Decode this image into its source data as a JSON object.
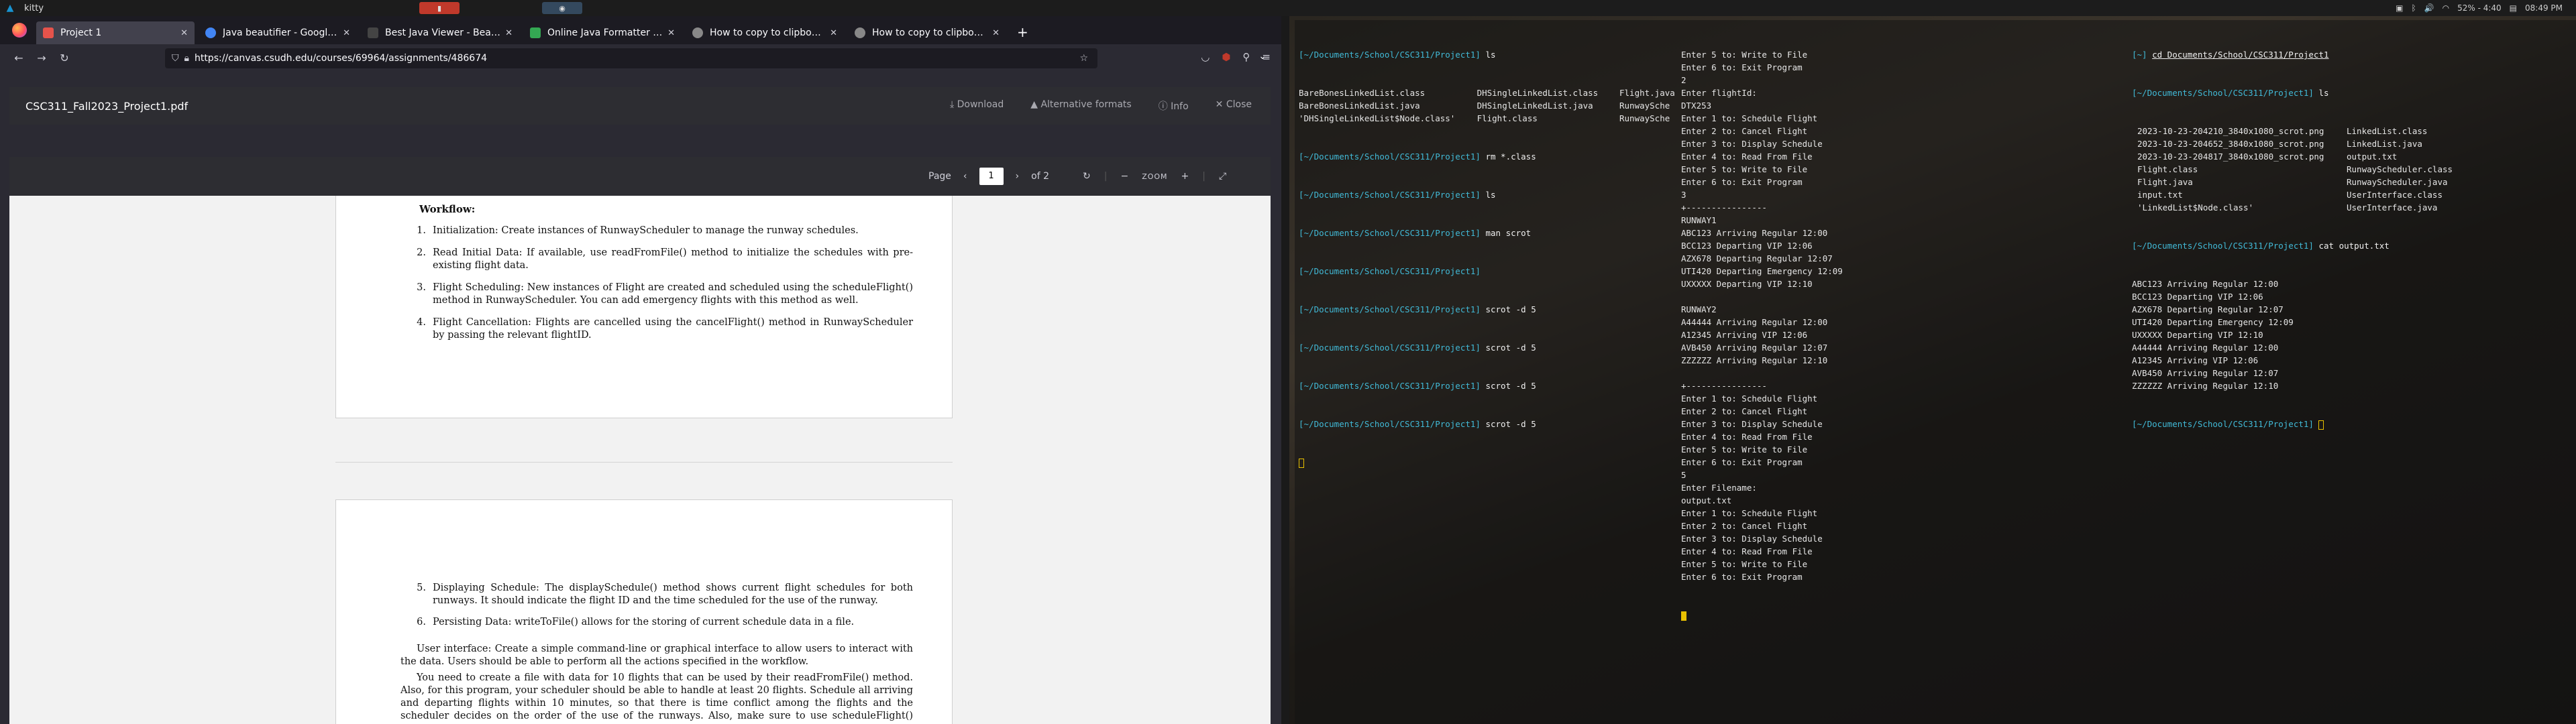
{
  "topbar": {
    "window_title": "kitty",
    "battery": "52% - 4:40",
    "time": "08:49 PM"
  },
  "browser": {
    "tabs": [
      {
        "label": "Project 1",
        "color": "#e5534b",
        "active": true
      },
      {
        "label": "Java beautifier - Google Se",
        "color": "#4285f4",
        "active": false
      },
      {
        "label": "Best Java Viewer - Beautify",
        "color": "#2b2b2b",
        "active": false
      },
      {
        "label": "Online Java Formatter | Tu",
        "color": "#34a853",
        "active": false
      },
      {
        "label": "How to copy to clipboard i",
        "color": "#7c7c7c",
        "active": false
      },
      {
        "label": "How to copy to clipboard i",
        "color": "#7c7c7c",
        "active": false
      }
    ],
    "url": "https://canvas.csudh.edu/courses/69964/assignments/486674"
  },
  "pdf": {
    "filename": "CSC311_Fall2023_Project1.pdf",
    "download": "Download",
    "alt_formats": "Alternative formats",
    "info": "Info",
    "close": "Close",
    "page_label": "Page",
    "page_current": "1",
    "page_total": "of 2",
    "zoom_label": "ZOOM",
    "workflow_title": "Workflow:",
    "items": [
      {
        "num": "1.",
        "text": "Initialization: Create instances of RunwayScheduler to manage the runway schedules."
      },
      {
        "num": "2.",
        "text": "Read Initial Data: If available, use readFromFile() method to initialize the schedules with pre-existing flight data."
      },
      {
        "num": "3.",
        "text": "Flight Scheduling: New instances of Flight are created and scheduled using the scheduleFlight() method in RunwayScheduler. You can add emergency flights with this method as well."
      },
      {
        "num": "4.",
        "text": "Flight Cancellation: Flights are cancelled using the cancelFlight() method in RunwayScheduler by passing the relevant flightID."
      }
    ],
    "items2": [
      {
        "num": "5.",
        "text": "Displaying Schedule: The displaySchedule() method shows current flight schedules for both runways. It should indicate the flight ID and the time scheduled for the use of the runway."
      },
      {
        "num": "6.",
        "text": "Persisting Data: writeToFile() allows for the storing of current schedule data in a file."
      }
    ],
    "para1": "User interface: Create a simple command-line or graphical interface to allow users to interact with the data. Users should be able to perform all the actions specified in the workflow.",
    "para2": "You need to create a file with data for 10 flights that can be used by their readFromFile() method. Also, for this program, your scheduler should be able to handle at least 20 flights. Schedule all arriving and departing flights within 10 minutes, so that there is time conflict among the flights and the scheduler decides on the order of the use of the runways. Also, make sure to use scheduleFlight() method to add"
  },
  "terminal1": {
    "ls1_cols": [
      [
        "BareBonesLinkedList.class",
        "BareBonesLinkedList.java",
        "'DHSingleLinkedList$Node.class'"
      ],
      [
        "DHSingleLinkedList.class",
        "DHSingleLinkedList.java",
        "Flight.class"
      ],
      [
        "Flight.java",
        "RunwaySche",
        "RunwaySche"
      ]
    ],
    "prompt": "[~/Documents/School/CSC311/Project1]",
    "lines": [
      {
        "p": true,
        "cmd": "ls"
      },
      {
        "p": true,
        "cmd": "rm *.class"
      },
      {
        "p": true,
        "cmd": "ls"
      },
      {
        "p": true,
        "cmd": "man scrot"
      },
      {
        "p": true,
        "cmd": ""
      },
      {
        "p": true,
        "cmd": "scrot -d 5"
      },
      {
        "p": true,
        "cmd": "scrot -d 5"
      },
      {
        "p": true,
        "cmd": "scrot -d 5"
      },
      {
        "p": true,
        "cmd": "scrot -d 5"
      }
    ]
  },
  "terminal2": {
    "lines": [
      "Enter 5 to: Write to File",
      "Enter 6 to: Exit Program",
      "2",
      "Enter flightId:",
      "DTX253",
      "Enter 1 to: Schedule Flight",
      "Enter 2 to: Cancel Flight",
      "Enter 3 to: Display Schedule",
      "Enter 4 to: Read From File",
      "Enter 5 to: Write to File",
      "Enter 6 to: Exit Program",
      "3",
      "+----------------",
      "RUNWAY1",
      "ABC123 Arriving Regular 12:00",
      "BCC123 Departing VIP 12:06",
      "AZX678 Departing Regular 12:07",
      "UTI420 Departing Emergency 12:09",
      "UXXXXX Departing VIP 12:10",
      "",
      "RUNWAY2",
      "A44444 Arriving Regular 12:00",
      "A12345 Arriving VIP 12:06",
      "AVB450 Arriving Regular 12:07",
      "ZZZZZZ Arriving Regular 12:10",
      "",
      "+----------------",
      "Enter 1 to: Schedule Flight",
      "Enter 2 to: Cancel Flight",
      "Enter 3 to: Display Schedule",
      "Enter 4 to: Read From File",
      "Enter 5 to: Write to File",
      "Enter 6 to: Exit Program",
      "5",
      "Enter Filename:",
      "output.txt",
      "Enter 1 to: Schedule Flight",
      "Enter 2 to: Cancel Flight",
      "Enter 3 to: Display Schedule",
      "Enter 4 to: Read From File",
      "Enter 5 to: Write to File",
      "Enter 6 to: Exit Program"
    ]
  },
  "terminal3": {
    "cd_prompt": "[~]",
    "cd_cmd": "cd Documents/School/CSC311/Project1",
    "prompt": "[~/Documents/School/CSC311/Project1]",
    "ls_cmd": "ls",
    "ls_cols": [
      [
        "2023-10-23-204210_3840x1080_scrot.png",
        "2023-10-23-204652_3840x1080_scrot.png",
        "2023-10-23-204817_3840x1080_scrot.png",
        "Flight.class",
        "Flight.java",
        "input.txt",
        "'LinkedList$Node.class'"
      ],
      [
        "LinkedList.class",
        "LinkedList.java",
        "output.txt",
        "RunwayScheduler.class",
        "RunwayScheduler.java",
        "UserInterface.class",
        "UserInterface.java"
      ]
    ],
    "cat_cmd": "cat output.txt",
    "output": [
      "ABC123 Arriving Regular 12:00",
      "BCC123 Departing VIP 12:06",
      "AZX678 Departing Regular 12:07",
      "UTI420 Departing Emergency 12:09",
      "UXXXXX Departing VIP 12:10",
      "A44444 Arriving Regular 12:00",
      "A12345 Arriving VIP 12:06",
      "AVB450 Arriving Regular 12:07",
      "ZZZZZZ Arriving Regular 12:10"
    ]
  }
}
